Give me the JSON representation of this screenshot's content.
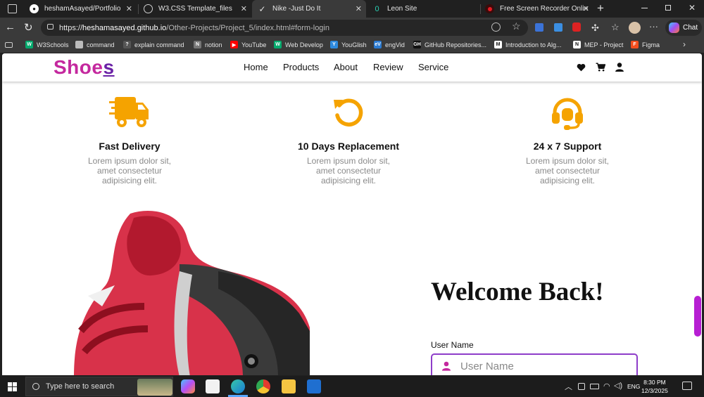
{
  "browser": {
    "tabs": [
      {
        "title": "heshamAsayed/Portfolio",
        "icon": "github-icon",
        "active": false
      },
      {
        "title": "W3.CSS Template_files",
        "icon": "globe-icon",
        "active": false
      },
      {
        "title": "Nike -Just Do It",
        "icon": "nike-icon",
        "active": true
      },
      {
        "title": "Leon Site",
        "icon": "leon-icon",
        "active": false
      },
      {
        "title": "Free Screen Recorder Online",
        "icon": "record-icon",
        "active": false
      }
    ],
    "address": {
      "scheme": "https://",
      "host": "heshamasayed.github.io",
      "path": "/Other-Projects/Project_5/index.html#form-login"
    },
    "chat_label": "Chat",
    "favorites": [
      {
        "label": "W3Schools",
        "color": "#04aa6d",
        "glyph": "W"
      },
      {
        "label": "command",
        "color": "#bbbbbb",
        "glyph": ""
      },
      {
        "label": "explain command",
        "color": "#555555",
        "glyph": "?"
      },
      {
        "label": "notion",
        "color": "#777777",
        "glyph": "N"
      },
      {
        "label": "YouTube",
        "color": "#ff0000",
        "glyph": "▶"
      },
      {
        "label": "Web Develop",
        "color": "#04aa6d",
        "glyph": "W"
      },
      {
        "label": "YouGlish",
        "color": "#2e8ade",
        "glyph": "Y"
      },
      {
        "label": "engVid",
        "color": "#2a7ad1",
        "glyph": "eV"
      },
      {
        "label": "GitHub Repositories...",
        "color": "#111111",
        "glyph": "GH"
      },
      {
        "label": "Introduction to Alg...",
        "color": "#ffffff",
        "glyph": "M"
      },
      {
        "label": "MEP - Project",
        "color": "#ffffff",
        "glyph": "N"
      },
      {
        "label": "Figma",
        "color": "#f24e1e",
        "glyph": "F"
      }
    ]
  },
  "site": {
    "logo_main": "Shoe",
    "logo_last": "s",
    "nav": [
      "Home",
      "Products",
      "About",
      "Review",
      "Service"
    ],
    "features": [
      {
        "title": "Fast Delivery",
        "text": "Lorem ipsum dolor sit, amet consectetur adipisicing elit.",
        "icon": "truck-icon"
      },
      {
        "title": "10 Days Replacement",
        "text": "Lorem ipsum dolor sit, amet consectetur adipisicing elit.",
        "icon": "rotate-icon"
      },
      {
        "title": "24 x 7 Support",
        "text": "Lorem ipsum dolor sit, amet consectetur adipisicing elit.",
        "icon": "headset-icon"
      }
    ],
    "accent_color": "#f5a300",
    "login": {
      "heading": "Welcome Back!",
      "username_label": "User Name",
      "username_placeholder": "User Name"
    }
  },
  "taskbar": {
    "search_placeholder": "Type here to search",
    "language": "ENG",
    "time": "8:30 PM",
    "date": "12/3/2025"
  }
}
